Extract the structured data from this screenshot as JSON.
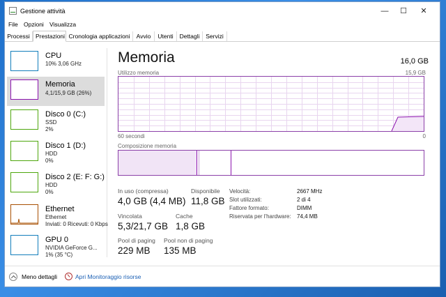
{
  "window": {
    "title": "Gestione attività"
  },
  "menu": [
    "File",
    "Opzioni",
    "Visualizza"
  ],
  "tabs": [
    "Processi",
    "Prestazioni",
    "Cronologia applicazioni",
    "Avvio",
    "Utenti",
    "Dettagli",
    "Servizi"
  ],
  "active_tab": "Prestazioni",
  "sidebar": [
    {
      "title": "CPU",
      "sub1": "10% 3,06 GHz",
      "sub2": "",
      "color": "#117dbb"
    },
    {
      "title": "Memoria",
      "sub1": "4,1/15,9 GB (26%)",
      "sub2": "",
      "color": "#8b12ae"
    },
    {
      "title": "Disco 0 (C:)",
      "sub1": "SSD",
      "sub2": "2%",
      "color": "#4da60c"
    },
    {
      "title": "Disco 1 (D:)",
      "sub1": "HDD",
      "sub2": "0%",
      "color": "#4da60c"
    },
    {
      "title": "Disco 2 (E: F: G:)",
      "sub1": "HDD",
      "sub2": "0%",
      "color": "#4da60c"
    },
    {
      "title": "Ethernet",
      "sub1": "Ethernet",
      "sub2": "Inviati: 0 Ricevuti: 0 Kbps",
      "color": "#a74f01"
    },
    {
      "title": "GPU 0",
      "sub1": "NVIDIA GeForce G...",
      "sub2": "1% (35 °C)",
      "color": "#117dbb"
    }
  ],
  "main": {
    "title": "Memoria",
    "total": "16,0 GB",
    "usage_label": "Utilizzo memoria",
    "usage_max": "15,9 GB",
    "time_label": "60 secondi",
    "zero_label": "0",
    "composition_label": "Composizione memoria",
    "stats": {
      "in_use_label": "In uso (compressa)",
      "in_use_value": "4,0 GB (4,4 MB)",
      "available_label": "Disponibile",
      "available_value": "11,8 GB",
      "committed_label": "Vincolata",
      "committed_value": "5,3/21,7 GB",
      "cache_label": "Cache",
      "cache_value": "1,8 GB",
      "paged_label": "Pool di paging",
      "paged_value": "229 MB",
      "nonpaged_label": "Pool non di paging",
      "nonpaged_value": "135 MB"
    },
    "details": [
      {
        "label": "Velocità:",
        "value": "2667 MHz"
      },
      {
        "label": "Slot utilizzati:",
        "value": "2 di 4"
      },
      {
        "label": "Fattore formato:",
        "value": "DIMM"
      },
      {
        "label": "Riservata per l'hardware:",
        "value": "74,4 MB"
      }
    ],
    "usage_fraction": 0.26
  },
  "footer": {
    "less_details": "Meno dettagli",
    "resource_monitor": "Apri Monitoraggio risorse"
  },
  "colors": {
    "memory": "#8b12ae",
    "grid": "#e8d5ef"
  }
}
